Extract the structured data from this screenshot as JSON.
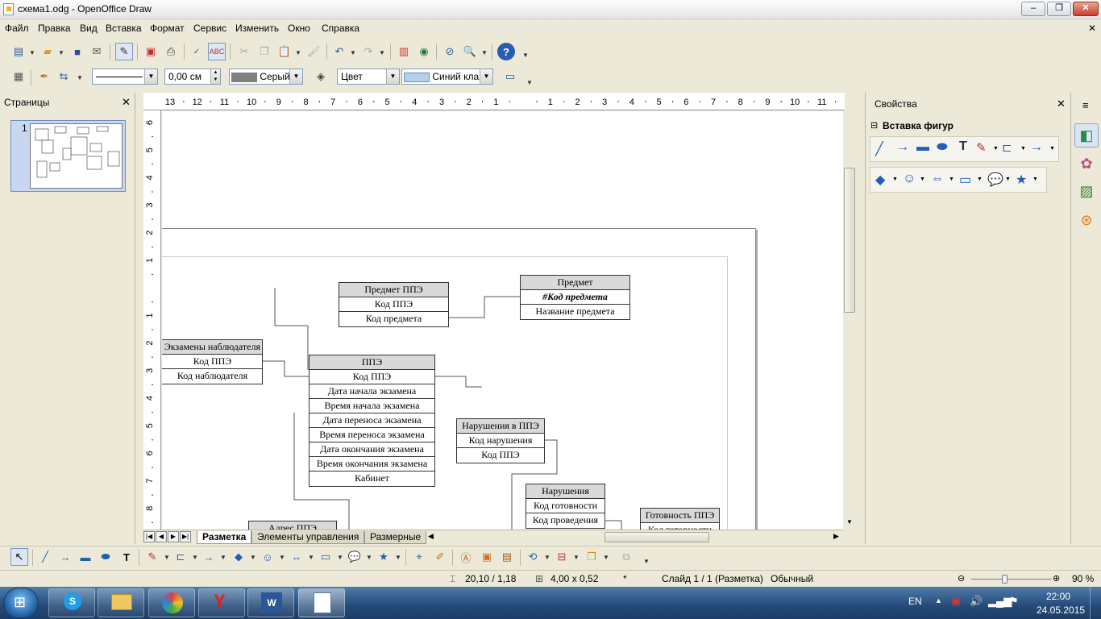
{
  "window": {
    "title": "схема1.odg - OpenOffice Draw",
    "minimize": "–",
    "restore": "❐",
    "close": "✕"
  },
  "menu": [
    "Файл",
    "Правка",
    "Вид",
    "Вставка",
    "Формат",
    "Сервис",
    "Изменить",
    "Окно",
    "Справка"
  ],
  "menu_close": "✕",
  "line_toolbar": {
    "line_width": "0,00 см",
    "line_color": "Серый",
    "area_style": "Цвет",
    "area_color": "Синий кла"
  },
  "pages_panel": {
    "title": "Страницы",
    "close": "✕",
    "page_number": "1"
  },
  "ruler_h": [
    "13",
    "12",
    "11",
    "10",
    "9",
    "8",
    "7",
    "6",
    "5",
    "4",
    "3",
    "2",
    "1",
    "",
    "1",
    "2",
    "3",
    "4",
    "5",
    "6",
    "7",
    "8",
    "9",
    "10",
    "11"
  ],
  "ruler_v": [
    "6",
    "5",
    "4",
    "3",
    "2",
    "1",
    "",
    "1",
    "2",
    "3",
    "4",
    "5",
    "6",
    "7",
    "8"
  ],
  "tabs": [
    "Разметка",
    "Элементы управления",
    "Размерные"
  ],
  "properties": {
    "title": "Свойства",
    "close": "✕",
    "menu": "≡",
    "section": "Вставка фигур",
    "collapse": "⊟"
  },
  "status": {
    "position": "20,10 / 1,18",
    "size": "4,00 x 0,52",
    "modified": "*",
    "slide": "Слайд 1 / 1 (Разметка)",
    "layout": "Обычный",
    "zoom": "90 %"
  },
  "taskbar": {
    "lang": "EN",
    "time": "22:00",
    "date": "24.05.2015"
  },
  "diagram": {
    "predmet_ppe": {
      "title": "Предмет ППЭ",
      "rows": [
        "Код ППЭ",
        "Код предмета"
      ]
    },
    "predmet": {
      "title": "Предмет",
      "rows": [
        "#Код предмета",
        "Название предмета"
      ]
    },
    "ekzameny": {
      "title": "Экзамены наблюдателя",
      "rows": [
        "Код ППЭ",
        "Код наблюдателя"
      ]
    },
    "ppe": {
      "title": "ППЭ",
      "rows": [
        "Код ППЭ",
        "Дата начала экзамена",
        "Время начала экзамена",
        "Дата переноса экзамена",
        "Время переноса экзамена",
        "Дата окончания экзамена",
        "Время окончания экзамена",
        "Кабинет"
      ]
    },
    "narusheniya_ppe": {
      "title": "Нарушения в ППЭ",
      "rows": [
        "Код нарушения",
        "Код ППЭ"
      ]
    },
    "narusheniya": {
      "title": "Нарушения",
      "rows": [
        "Код готовности",
        "Код проведения"
      ]
    },
    "gotovnost": {
      "title": "Готовность ППЭ",
      "rows": [
        "Код готовности"
      ]
    },
    "adres": {
      "title": "Адрес ППЭ"
    }
  }
}
